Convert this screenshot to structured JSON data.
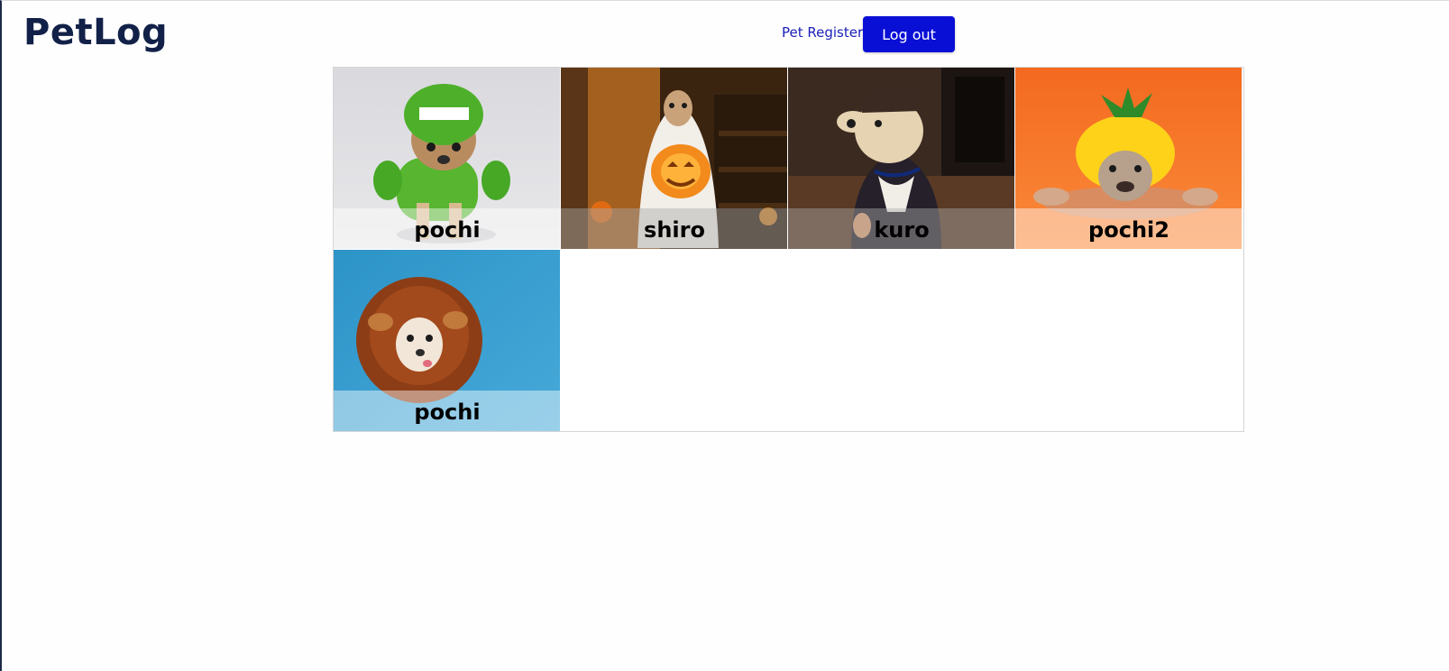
{
  "header": {
    "logo": "PetLog",
    "nav_link": "Pet Register",
    "logout_label": "Log out"
  },
  "pets": [
    {
      "name": "pochi",
      "photo": "chihuahua-dinosaur-costume"
    },
    {
      "name": "shiro",
      "photo": "dog-ghost-costume-pumpkin"
    },
    {
      "name": "kuro",
      "photo": "labrador-delivery-uniform"
    },
    {
      "name": "pochi2",
      "photo": "bulldog-pineapple-costume"
    },
    {
      "name": "pochi",
      "photo": "chihuahua-lion-mane"
    }
  ],
  "colors": {
    "brand": "#122148",
    "button": "#0a0fd6",
    "link": "#1a1fb8"
  }
}
